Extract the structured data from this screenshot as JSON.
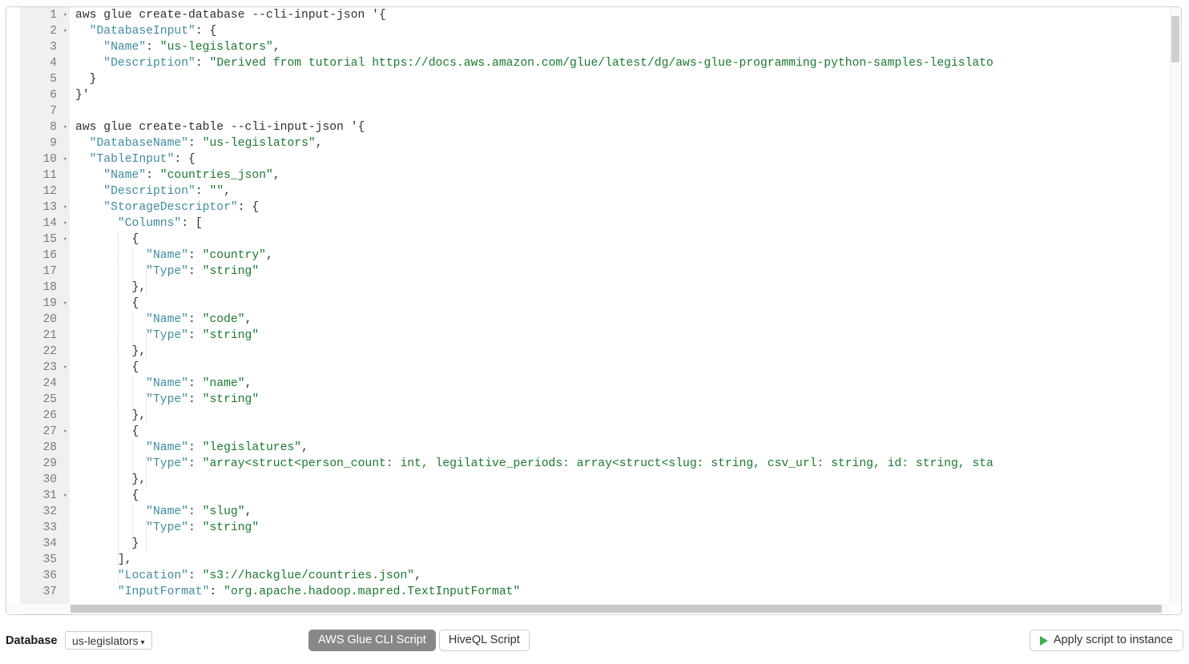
{
  "editor": {
    "language": "shell-json",
    "first_visible_line": 1,
    "last_visible_line": 37,
    "gutter_bg": "#f0f0f0",
    "key_color": "#3f8ba0",
    "string_color": "#1a7a2e",
    "fold_arrow_glyph": "▾",
    "lines": [
      {
        "n": 1,
        "fold": true,
        "tokens": [
          {
            "t": "plain",
            "v": "aws glue create-database --cli-input-json '{"
          }
        ]
      },
      {
        "n": 2,
        "fold": true,
        "tokens": [
          {
            "t": "plain",
            "v": "  "
          },
          {
            "t": "key",
            "v": "\"DatabaseInput\""
          },
          {
            "t": "punct",
            "v": ": {"
          }
        ]
      },
      {
        "n": 3,
        "fold": false,
        "tokens": [
          {
            "t": "plain",
            "v": "    "
          },
          {
            "t": "key",
            "v": "\"Name\""
          },
          {
            "t": "punct",
            "v": ": "
          },
          {
            "t": "str",
            "v": "\"us-legislators\""
          },
          {
            "t": "punct",
            "v": ","
          }
        ]
      },
      {
        "n": 4,
        "fold": false,
        "tokens": [
          {
            "t": "plain",
            "v": "    "
          },
          {
            "t": "key",
            "v": "\"Description\""
          },
          {
            "t": "punct",
            "v": ": "
          },
          {
            "t": "str",
            "v": "\"Derived from tutorial https://docs.aws.amazon.com/glue/latest/dg/aws-glue-programming-python-samples-legislato"
          }
        ]
      },
      {
        "n": 5,
        "fold": false,
        "tokens": [
          {
            "t": "punct",
            "v": "  }"
          }
        ]
      },
      {
        "n": 6,
        "fold": false,
        "tokens": [
          {
            "t": "punct",
            "v": "}'"
          }
        ]
      },
      {
        "n": 7,
        "fold": false,
        "tokens": []
      },
      {
        "n": 8,
        "fold": true,
        "tokens": [
          {
            "t": "plain",
            "v": "aws glue create-table --cli-input-json '{"
          }
        ]
      },
      {
        "n": 9,
        "fold": false,
        "tokens": [
          {
            "t": "plain",
            "v": "  "
          },
          {
            "t": "key",
            "v": "\"DatabaseName\""
          },
          {
            "t": "punct",
            "v": ": "
          },
          {
            "t": "str",
            "v": "\"us-legislators\""
          },
          {
            "t": "punct",
            "v": ","
          }
        ]
      },
      {
        "n": 10,
        "fold": true,
        "tokens": [
          {
            "t": "plain",
            "v": "  "
          },
          {
            "t": "key",
            "v": "\"TableInput\""
          },
          {
            "t": "punct",
            "v": ": {"
          }
        ]
      },
      {
        "n": 11,
        "fold": false,
        "tokens": [
          {
            "t": "plain",
            "v": "    "
          },
          {
            "t": "key",
            "v": "\"Name\""
          },
          {
            "t": "punct",
            "v": ": "
          },
          {
            "t": "str",
            "v": "\"countries_json\""
          },
          {
            "t": "punct",
            "v": ","
          }
        ]
      },
      {
        "n": 12,
        "fold": false,
        "tokens": [
          {
            "t": "plain",
            "v": "    "
          },
          {
            "t": "key",
            "v": "\"Description\""
          },
          {
            "t": "punct",
            "v": ": "
          },
          {
            "t": "str",
            "v": "\"\""
          },
          {
            "t": "punct",
            "v": ","
          }
        ]
      },
      {
        "n": 13,
        "fold": true,
        "tokens": [
          {
            "t": "plain",
            "v": "    "
          },
          {
            "t": "key",
            "v": "\"StorageDescriptor\""
          },
          {
            "t": "punct",
            "v": ": {"
          }
        ]
      },
      {
        "n": 14,
        "fold": true,
        "tokens": [
          {
            "t": "plain",
            "v": "      "
          },
          {
            "t": "key",
            "v": "\"Columns\""
          },
          {
            "t": "punct",
            "v": ": ["
          }
        ]
      },
      {
        "n": 15,
        "fold": true,
        "tokens": [
          {
            "t": "punct",
            "v": "        {"
          }
        ]
      },
      {
        "n": 16,
        "fold": false,
        "tokens": [
          {
            "t": "plain",
            "v": "          "
          },
          {
            "t": "key",
            "v": "\"Name\""
          },
          {
            "t": "punct",
            "v": ": "
          },
          {
            "t": "str",
            "v": "\"country\""
          },
          {
            "t": "punct",
            "v": ","
          }
        ]
      },
      {
        "n": 17,
        "fold": false,
        "tokens": [
          {
            "t": "plain",
            "v": "          "
          },
          {
            "t": "key",
            "v": "\"Type\""
          },
          {
            "t": "punct",
            "v": ": "
          },
          {
            "t": "str",
            "v": "\"string\""
          }
        ]
      },
      {
        "n": 18,
        "fold": false,
        "tokens": [
          {
            "t": "punct",
            "v": "        },"
          }
        ]
      },
      {
        "n": 19,
        "fold": true,
        "tokens": [
          {
            "t": "punct",
            "v": "        {"
          }
        ]
      },
      {
        "n": 20,
        "fold": false,
        "tokens": [
          {
            "t": "plain",
            "v": "          "
          },
          {
            "t": "key",
            "v": "\"Name\""
          },
          {
            "t": "punct",
            "v": ": "
          },
          {
            "t": "str",
            "v": "\"code\""
          },
          {
            "t": "punct",
            "v": ","
          }
        ]
      },
      {
        "n": 21,
        "fold": false,
        "tokens": [
          {
            "t": "plain",
            "v": "          "
          },
          {
            "t": "key",
            "v": "\"Type\""
          },
          {
            "t": "punct",
            "v": ": "
          },
          {
            "t": "str",
            "v": "\"string\""
          }
        ]
      },
      {
        "n": 22,
        "fold": false,
        "tokens": [
          {
            "t": "punct",
            "v": "        },"
          }
        ]
      },
      {
        "n": 23,
        "fold": true,
        "tokens": [
          {
            "t": "punct",
            "v": "        {"
          }
        ]
      },
      {
        "n": 24,
        "fold": false,
        "tokens": [
          {
            "t": "plain",
            "v": "          "
          },
          {
            "t": "key",
            "v": "\"Name\""
          },
          {
            "t": "punct",
            "v": ": "
          },
          {
            "t": "str",
            "v": "\"name\""
          },
          {
            "t": "punct",
            "v": ","
          }
        ]
      },
      {
        "n": 25,
        "fold": false,
        "tokens": [
          {
            "t": "plain",
            "v": "          "
          },
          {
            "t": "key",
            "v": "\"Type\""
          },
          {
            "t": "punct",
            "v": ": "
          },
          {
            "t": "str",
            "v": "\"string\""
          }
        ]
      },
      {
        "n": 26,
        "fold": false,
        "tokens": [
          {
            "t": "punct",
            "v": "        },"
          }
        ]
      },
      {
        "n": 27,
        "fold": true,
        "tokens": [
          {
            "t": "punct",
            "v": "        {"
          }
        ]
      },
      {
        "n": 28,
        "fold": false,
        "tokens": [
          {
            "t": "plain",
            "v": "          "
          },
          {
            "t": "key",
            "v": "\"Name\""
          },
          {
            "t": "punct",
            "v": ": "
          },
          {
            "t": "str",
            "v": "\"legislatures\""
          },
          {
            "t": "punct",
            "v": ","
          }
        ]
      },
      {
        "n": 29,
        "fold": false,
        "tokens": [
          {
            "t": "plain",
            "v": "          "
          },
          {
            "t": "key",
            "v": "\"Type\""
          },
          {
            "t": "punct",
            "v": ": "
          },
          {
            "t": "str",
            "v": "\"array<struct<person_count: int, legilative_periods: array<struct<slug: string, csv_url: string, id: string, sta"
          }
        ]
      },
      {
        "n": 30,
        "fold": false,
        "tokens": [
          {
            "t": "punct",
            "v": "        },"
          }
        ]
      },
      {
        "n": 31,
        "fold": true,
        "tokens": [
          {
            "t": "punct",
            "v": "        {"
          }
        ]
      },
      {
        "n": 32,
        "fold": false,
        "tokens": [
          {
            "t": "plain",
            "v": "          "
          },
          {
            "t": "key",
            "v": "\"Name\""
          },
          {
            "t": "punct",
            "v": ": "
          },
          {
            "t": "str",
            "v": "\"slug\""
          },
          {
            "t": "punct",
            "v": ","
          }
        ]
      },
      {
        "n": 33,
        "fold": false,
        "tokens": [
          {
            "t": "plain",
            "v": "          "
          },
          {
            "t": "key",
            "v": "\"Type\""
          },
          {
            "t": "punct",
            "v": ": "
          },
          {
            "t": "str",
            "v": "\"string\""
          }
        ]
      },
      {
        "n": 34,
        "fold": false,
        "tokens": [
          {
            "t": "punct",
            "v": "        }"
          }
        ]
      },
      {
        "n": 35,
        "fold": false,
        "tokens": [
          {
            "t": "punct",
            "v": "      ],"
          }
        ]
      },
      {
        "n": 36,
        "fold": false,
        "tokens": [
          {
            "t": "plain",
            "v": "      "
          },
          {
            "t": "key",
            "v": "\"Location\""
          },
          {
            "t": "punct",
            "v": ": "
          },
          {
            "t": "str",
            "v": "\"s3://hackglue/countries.json\""
          },
          {
            "t": "punct",
            "v": ","
          }
        ]
      },
      {
        "n": 37,
        "fold": false,
        "tokens": [
          {
            "t": "plain",
            "v": "      "
          },
          {
            "t": "key",
            "v": "\"InputFormat\""
          },
          {
            "t": "punct",
            "v": ": "
          },
          {
            "t": "str",
            "v": "\"org.apache.hadoop.mapred.TextInputFormat\""
          }
        ]
      }
    ]
  },
  "toolbar": {
    "database_label": "Database",
    "database_value": "us-legislators",
    "database_caret": "▾",
    "tabs": [
      {
        "label": "AWS Glue CLI Script",
        "active": true
      },
      {
        "label": "HiveQL Script",
        "active": false
      }
    ],
    "apply_button_label": "Apply script to instance",
    "apply_button_icon": "play-icon",
    "apply_icon_color": "#3dae4e",
    "active_tab_color": "#888888"
  }
}
